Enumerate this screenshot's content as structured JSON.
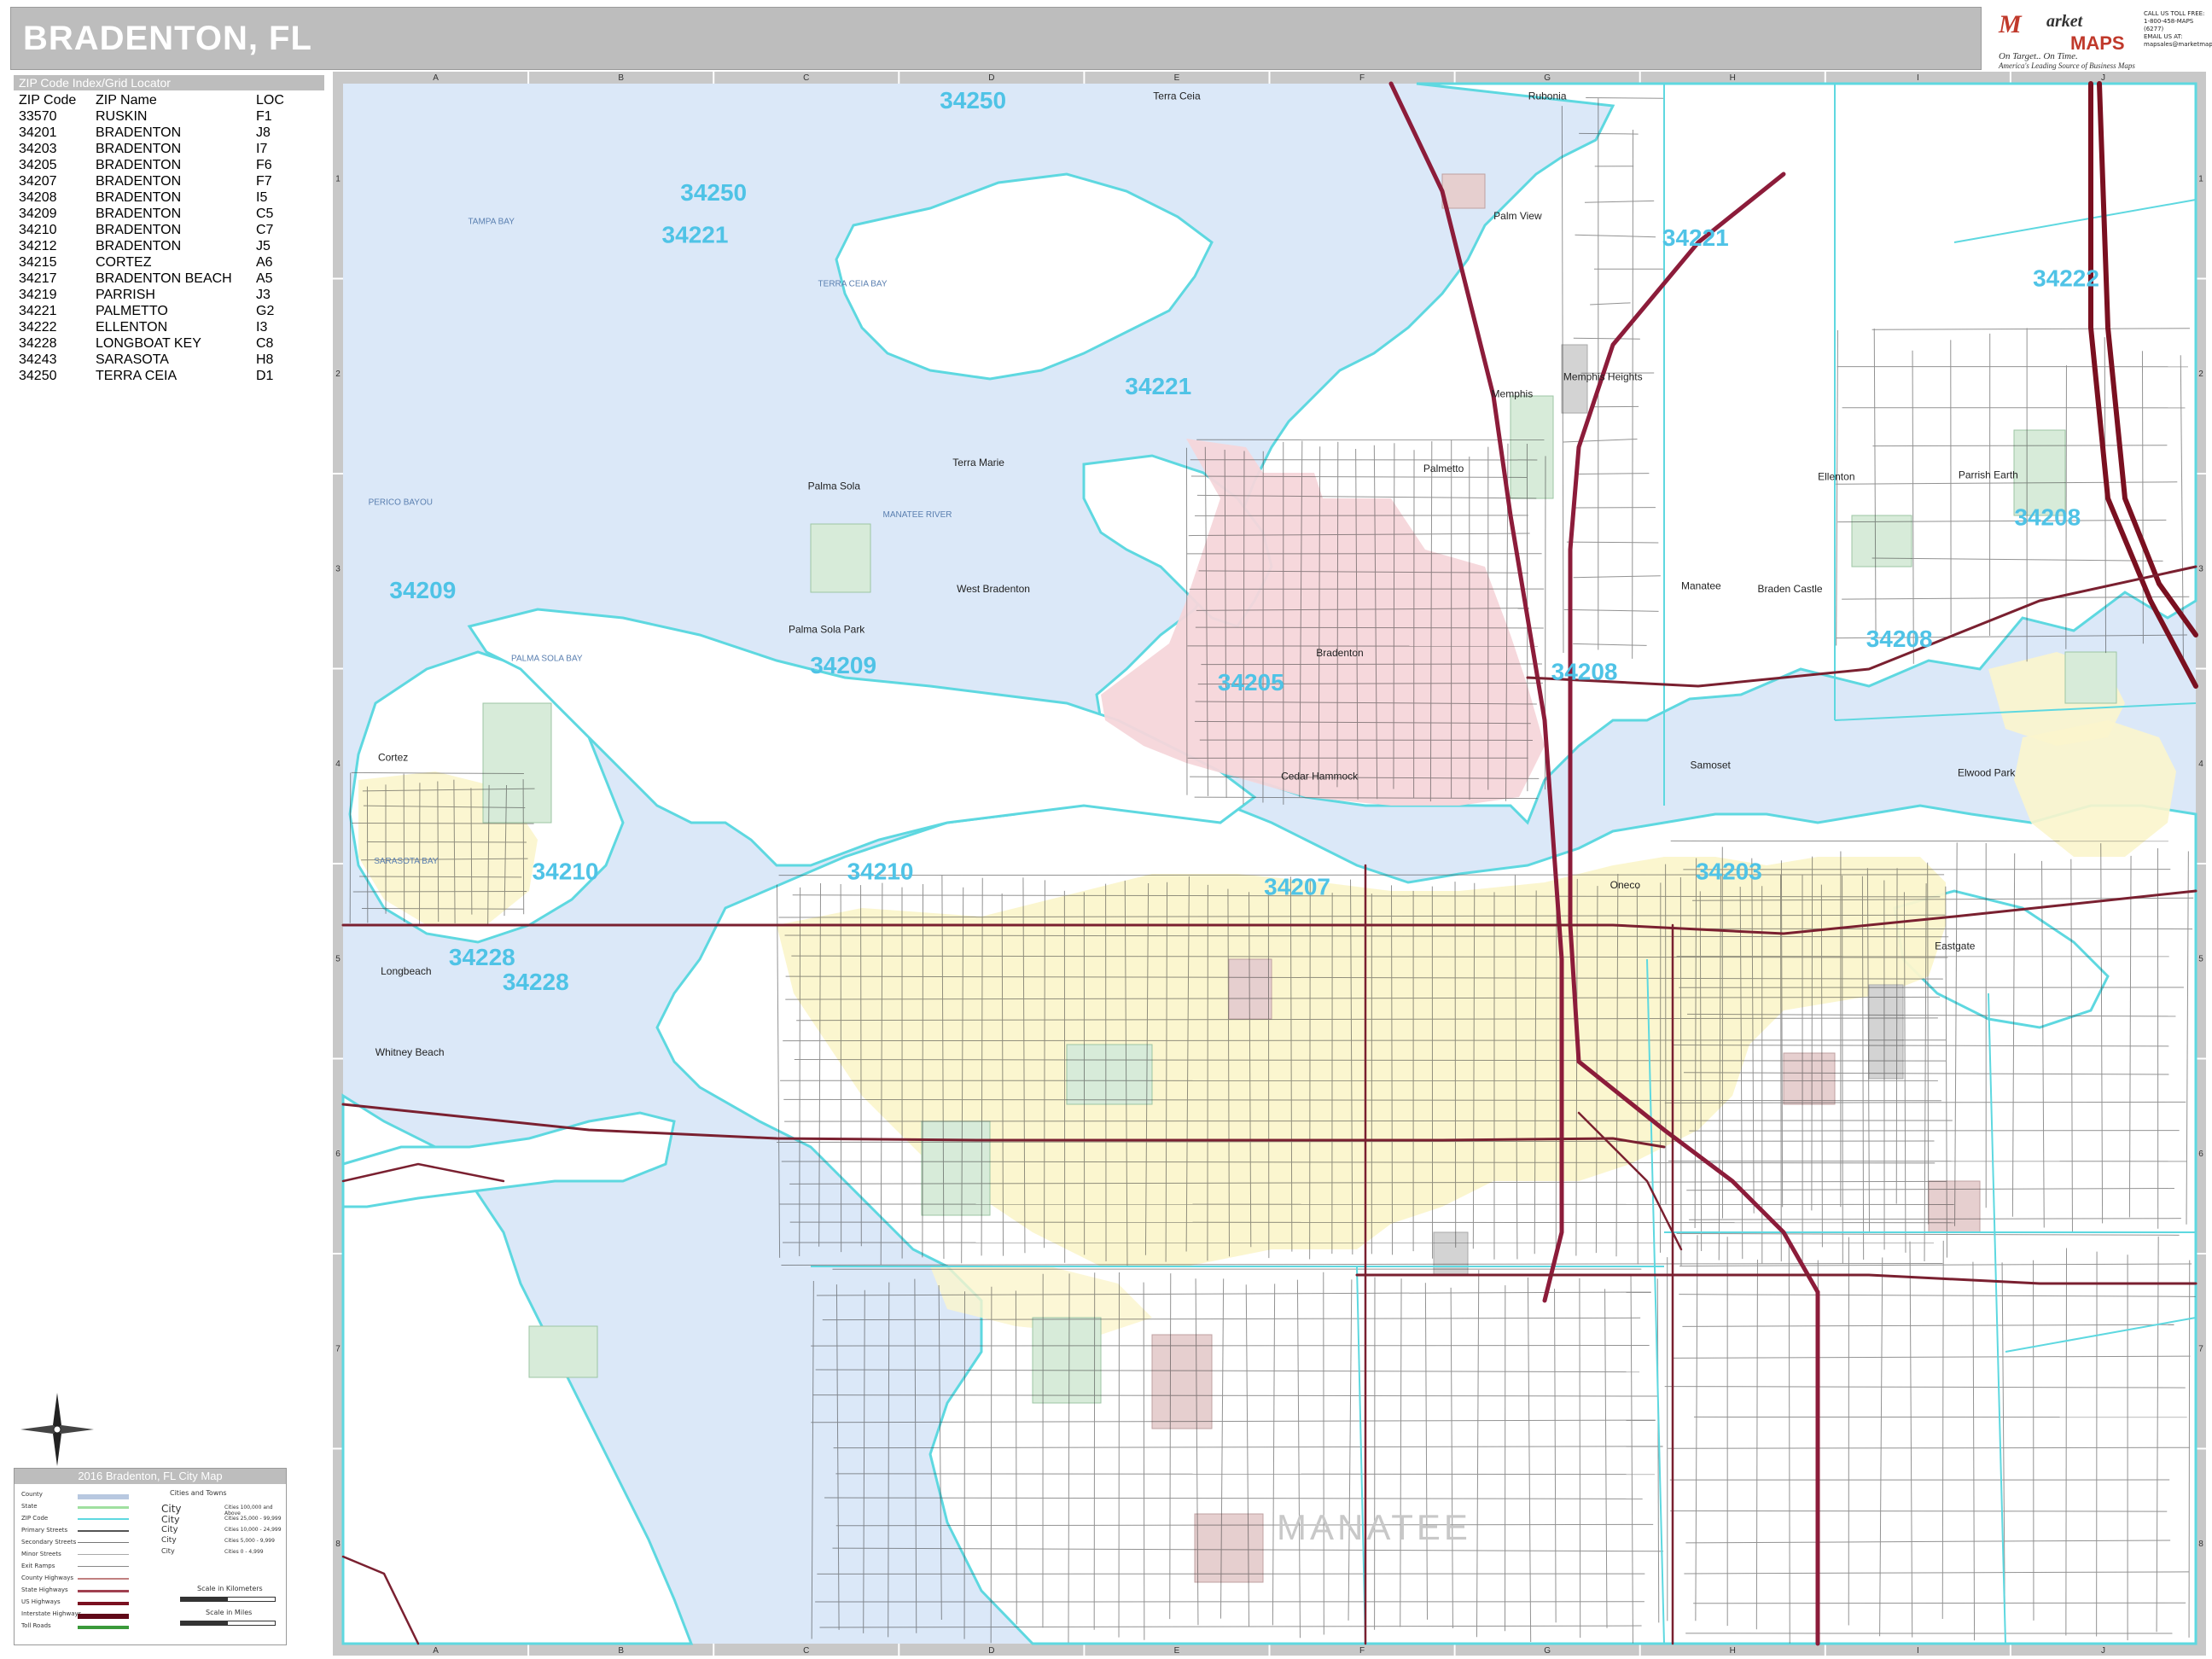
{
  "title": "BRADENTON, FL",
  "logo": {
    "word1": "M",
    "word2": "arket",
    "word3": "MAPS",
    "tagline": "On Target.. On Time.",
    "subtitle": "America's Leading Source of Business Maps"
  },
  "contact": [
    "CALL US TOLL FREE:",
    "1-800-458-MAPS (6277)",
    "",
    "EMAIL US AT:",
    "mapsales@marketmaps.com"
  ],
  "zip_index": {
    "heading": "ZIP Code Index/Grid Locator",
    "columns": [
      "ZIP Code",
      "ZIP Name",
      "LOC"
    ],
    "rows": [
      [
        "33570",
        "RUSKIN",
        "F1"
      ],
      [
        "34201",
        "BRADENTON",
        "J8"
      ],
      [
        "34203",
        "BRADENTON",
        "I7"
      ],
      [
        "34205",
        "BRADENTON",
        "F6"
      ],
      [
        "34207",
        "BRADENTON",
        "F7"
      ],
      [
        "34208",
        "BRADENTON",
        "I5"
      ],
      [
        "34209",
        "BRADENTON",
        "C5"
      ],
      [
        "34210",
        "BRADENTON",
        "C7"
      ],
      [
        "34212",
        "BRADENTON",
        "J5"
      ],
      [
        "34215",
        "CORTEZ",
        "A6"
      ],
      [
        "34217",
        "BRADENTON BEACH",
        "A5"
      ],
      [
        "34219",
        "PARRISH",
        "J3"
      ],
      [
        "34221",
        "PALMETTO",
        "G2"
      ],
      [
        "34222",
        "ELLENTON",
        "I3"
      ],
      [
        "34228",
        "LONGBOAT KEY",
        "C8"
      ],
      [
        "34243",
        "SARASOTA",
        "H8"
      ],
      [
        "34250",
        "TERRA CEIA",
        "D1"
      ]
    ]
  },
  "grid": {
    "columns": [
      "A",
      "B",
      "C",
      "D",
      "E",
      "F",
      "G",
      "H",
      "I",
      "J"
    ],
    "rows": [
      "1",
      "2",
      "3",
      "4",
      "5",
      "6",
      "7",
      "8"
    ]
  },
  "zip_labels": [
    {
      "text": "34250",
      "gx": 0.34,
      "gy": 0.016
    },
    {
      "text": "34250",
      "gx": 0.2,
      "gy": 0.075
    },
    {
      "text": "34221",
      "gx": 0.19,
      "gy": 0.102
    },
    {
      "text": "34221",
      "gx": 0.44,
      "gy": 0.199
    },
    {
      "text": "34221",
      "gx": 0.73,
      "gy": 0.104
    },
    {
      "text": "34222",
      "gx": 0.93,
      "gy": 0.13
    },
    {
      "text": "34209",
      "gx": 0.043,
      "gy": 0.33
    },
    {
      "text": "34209",
      "gx": 0.27,
      "gy": 0.378
    },
    {
      "text": "34205",
      "gx": 0.49,
      "gy": 0.389
    },
    {
      "text": "34208",
      "gx": 0.67,
      "gy": 0.382
    },
    {
      "text": "34208",
      "gx": 0.92,
      "gy": 0.283
    },
    {
      "text": "34210",
      "gx": 0.12,
      "gy": 0.51
    },
    {
      "text": "34210",
      "gx": 0.29,
      "gy": 0.51
    },
    {
      "text": "34207",
      "gx": 0.515,
      "gy": 0.52
    },
    {
      "text": "34203",
      "gx": 0.748,
      "gy": 0.51
    },
    {
      "text": "34208",
      "gx": 0.84,
      "gy": 0.361
    },
    {
      "text": "34228",
      "gx": 0.075,
      "gy": 0.565
    },
    {
      "text": "34228",
      "gx": 0.104,
      "gy": 0.581
    }
  ],
  "place_labels": [
    {
      "text": "Terra Ceia",
      "gx": 0.45,
      "gy": 0.01
    },
    {
      "text": "Rubonia",
      "gx": 0.65,
      "gy": 0.01
    },
    {
      "text": "Palm View",
      "gx": 0.634,
      "gy": 0.087
    },
    {
      "text": "Memphis",
      "gx": 0.631,
      "gy": 0.201
    },
    {
      "text": "Memphis Heights",
      "gx": 0.68,
      "gy": 0.19
    },
    {
      "text": "Terra Marie",
      "gx": 0.343,
      "gy": 0.245
    },
    {
      "text": "Palmetto",
      "gx": 0.594,
      "gy": 0.249
    },
    {
      "text": "Ellenton",
      "gx": 0.806,
      "gy": 0.254
    },
    {
      "text": "Parrish Earth",
      "gx": 0.888,
      "gy": 0.253
    },
    {
      "text": "Palma Sola",
      "gx": 0.265,
      "gy": 0.26
    },
    {
      "text": "West Bradenton",
      "gx": 0.351,
      "gy": 0.326
    },
    {
      "text": "Manatee",
      "gx": 0.733,
      "gy": 0.324
    },
    {
      "text": "Braden Castle",
      "gx": 0.781,
      "gy": 0.326
    },
    {
      "text": "Palma Sola Park",
      "gx": 0.261,
      "gy": 0.352
    },
    {
      "text": "Bradenton",
      "gx": 0.538,
      "gy": 0.367
    },
    {
      "text": "Samoset",
      "gx": 0.738,
      "gy": 0.439
    },
    {
      "text": "Elwood Park",
      "gx": 0.887,
      "gy": 0.444
    },
    {
      "text": "Cedar Hammock",
      "gx": 0.527,
      "gy": 0.446
    },
    {
      "text": "Cortez",
      "gx": 0.027,
      "gy": 0.434
    },
    {
      "text": "Oneco",
      "gx": 0.692,
      "gy": 0.516
    },
    {
      "text": "Longbeach",
      "gx": 0.034,
      "gy": 0.571
    },
    {
      "text": "Whitney Beach",
      "gx": 0.036,
      "gy": 0.623
    },
    {
      "text": "Eastgate",
      "gx": 0.87,
      "gy": 0.555
    }
  ],
  "water_labels": [
    {
      "text": "TAMPA BAY",
      "gx": 0.08,
      "gy": 0.09
    },
    {
      "text": "TERRA CEIA BAY",
      "gx": 0.275,
      "gy": 0.13
    },
    {
      "text": "MANATEE RIVER",
      "gx": 0.31,
      "gy": 0.278
    },
    {
      "text": "PALMA SOLA BAY",
      "gx": 0.11,
      "gy": 0.37
    },
    {
      "text": "SARASOTA BAY",
      "gx": 0.034,
      "gy": 0.5
    },
    {
      "text": "PERICO BAYOU",
      "gx": 0.031,
      "gy": 0.27
    }
  ],
  "county_label": "MANATEE",
  "legend": {
    "title": "2016 Bradenton, FL City Map",
    "items": [
      "County",
      "State",
      "ZIP Code",
      "Primary Streets",
      "Secondary Streets",
      "Minor Streets",
      "Exit Ramps",
      "County Highways",
      "State Highways",
      "US Highways",
      "Interstate Highways",
      "Toll Roads"
    ],
    "cities_heading": "Cities and Towns",
    "city_sizes": [
      "Cities 100,000 and Above",
      "Cities 25,000 - 99,999",
      "Cities 10,000 - 24,999",
      "Cities 5,000 - 9,999",
      "Cities 0 - 4,999"
    ],
    "city_word": "City",
    "scale_km": "Scale in Kilometers",
    "scale_mi": "Scale in Miles"
  },
  "colors": {
    "water": "#dbe8f8",
    "land": "#ffffff",
    "zip_boundary": "#5ed8e0",
    "palmetto_city": "#f6d6da",
    "bradenton_city": "#fbf5cc",
    "park": "#d7ebd9",
    "highway": "#8c1c3a",
    "us_hwy": "#7a1020",
    "street": "#2a2a2a"
  }
}
